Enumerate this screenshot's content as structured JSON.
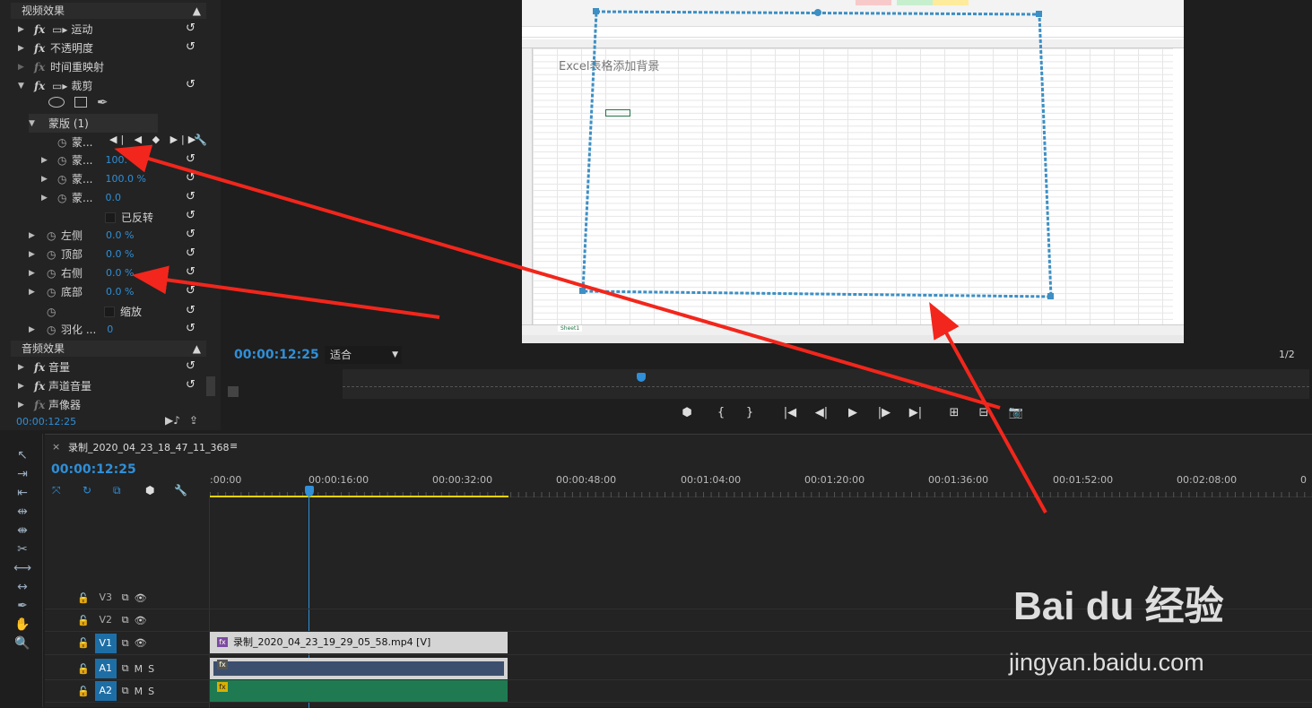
{
  "effect_controls": {
    "video_effects": "视频效果",
    "rows": [
      {
        "label": "运动",
        "fx": "fx"
      },
      {
        "label": "不透明度",
        "fx": "fx"
      },
      {
        "label": "时间重映射",
        "fx": "fx"
      },
      {
        "label": "裁剪",
        "fx": "fx"
      }
    ],
    "mask_label": "蒙版 (1)",
    "mask_rows": [
      {
        "label": "蒙...",
        "value": ""
      },
      {
        "label": "蒙...",
        "value": "100."
      },
      {
        "label": "蒙...",
        "value": "100.0 %"
      },
      {
        "label": "蒙...",
        "value": "0.0"
      }
    ],
    "inverted": "已反转",
    "crop_rows": [
      {
        "label": "左侧",
        "value": "0.0 %"
      },
      {
        "label": "顶部",
        "value": "0.0 %"
      },
      {
        "label": "右侧",
        "value": "0.0 %"
      },
      {
        "label": "底部",
        "value": "0.0 %"
      }
    ],
    "zoom": "缩放",
    "feather": {
      "label": "羽化 ...",
      "value": "0"
    },
    "audio_effects": "音频效果",
    "audio_rows": [
      "音量",
      "声道音量",
      "声像器"
    ],
    "timecode": "00:00:12:25"
  },
  "monitor": {
    "excel_text": "Excel表格添加背景",
    "sheet_tab": "Sheet1",
    "timecode": "00:00:12:25",
    "fit": "适合",
    "page": "1/2"
  },
  "timeline": {
    "sequence_name": "录制_2020_04_23_18_47_11_368",
    "timecode": "00:00:12:25",
    "ruler": [
      ":00:00",
      "00:00:16:00",
      "00:00:32:00",
      "00:00:48:00",
      "00:01:04:00",
      "00:01:20:00",
      "00:01:36:00",
      "00:01:52:00",
      "00:02:08:00",
      "0"
    ],
    "tracks": [
      {
        "name": "V3"
      },
      {
        "name": "V2"
      },
      {
        "name": "V1"
      },
      {
        "name": "A1"
      },
      {
        "name": "A2"
      }
    ],
    "clip_name": "录制_2020_04_23_19_29_05_58.mp4 [V]",
    "audio_m": "M",
    "audio_s": "S"
  },
  "watermark": {
    "brand": "Bai du 经验",
    "url": "jingyan.baidu.com"
  }
}
